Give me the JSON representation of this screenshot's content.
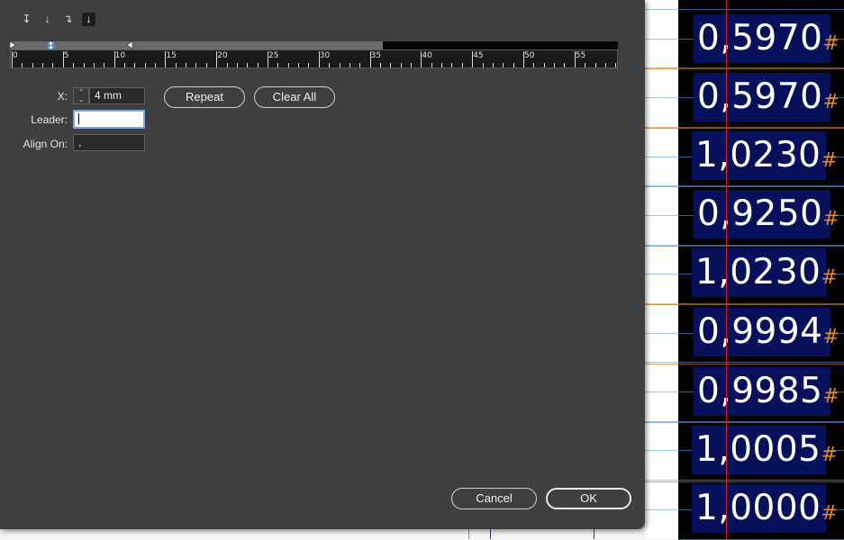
{
  "dialog": {
    "alignment_buttons": [
      {
        "icon": "left-justified-tab-icon",
        "glyph": "↧",
        "active": false
      },
      {
        "icon": "center-justified-tab-icon",
        "glyph": "↓",
        "active": false
      },
      {
        "icon": "right-justified-tab-icon",
        "glyph": "↴",
        "active": false
      },
      {
        "icon": "align-to-decimal-tab-icon",
        "glyph": "↓",
        "active": true
      }
    ],
    "ruler": {
      "labels": [
        "0",
        "5",
        "10",
        "15",
        "20",
        "25",
        "30",
        "35",
        "40",
        "45",
        "50",
        "55"
      ]
    },
    "fields": {
      "x_label": "X:",
      "x_value": "4 mm",
      "leader_label": "Leader:",
      "leader_value": "",
      "align_on_label": "Align On:",
      "align_on_value": ","
    },
    "buttons": {
      "repeat": "Repeat",
      "clear_all": "Clear All",
      "cancel": "Cancel",
      "ok": "OK"
    }
  },
  "document": {
    "cells": [
      {
        "text": "0,5970",
        "hash": "#"
      },
      {
        "text": "0,5970",
        "hash": "#"
      },
      {
        "text": "1,0230",
        "hash": "#"
      },
      {
        "text": "0,9250",
        "hash": "#"
      },
      {
        "text": "1,0230",
        "hash": "#"
      },
      {
        "text": "0,9994",
        "hash": "#"
      },
      {
        "text": "0,9985",
        "hash": "#"
      },
      {
        "text": "1,0005",
        "hash": "#"
      },
      {
        "text": "1,0000",
        "hash": "#"
      }
    ],
    "colors": {
      "cell_bg": "#07105a",
      "hash": "#e5892c",
      "guide": "#d6202a"
    }
  }
}
